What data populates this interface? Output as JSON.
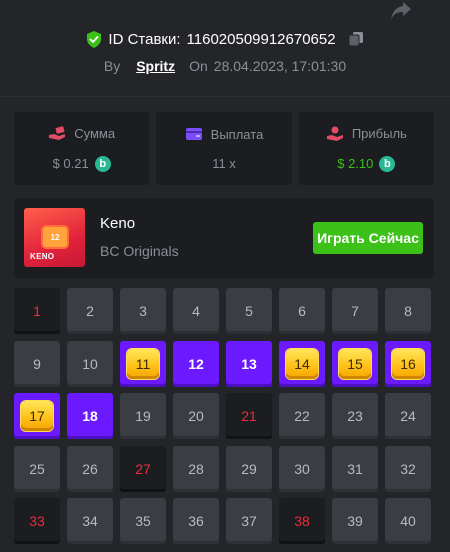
{
  "header": {
    "bet_id_label": "ID Ставки:",
    "bet_id_value": "116020509912670652",
    "by_label": "By",
    "user": "Spritz",
    "on_label": "On",
    "date": "28.04.2023, 17:01:30",
    "icons": {
      "share": "share-icon",
      "shield": "shield-check-icon",
      "copy": "copy-icon"
    },
    "colors": {
      "shield": "#3bc117"
    }
  },
  "stats": [
    {
      "label": "Сумма",
      "value": "$ 0.21",
      "icon": "money-hand-icon",
      "coin": true
    },
    {
      "label": "Выплата",
      "value": "11 x",
      "icon": "wallet-icon",
      "coin": false
    },
    {
      "label": "Прибыль",
      "value": "$ 2.10",
      "icon": "coins-hand-icon",
      "coin": true
    }
  ],
  "coin_symbol": "b",
  "game": {
    "name": "Keno",
    "provider": "BC Originals",
    "play_label": "Играть Сейчас",
    "thumb_logo": "KENO",
    "thumb_tile": "12"
  },
  "colors": {
    "accent_green": "#3bc117",
    "picked": "#6b19ff",
    "miss_text": "#ed2c3c",
    "gem": "#ffc21a"
  },
  "grid": {
    "numbers": [
      "1",
      "2",
      "3",
      "4",
      "5",
      "6",
      "7",
      "8",
      "9",
      "10",
      "11",
      "12",
      "13",
      "14",
      "15",
      "16",
      "17",
      "18",
      "19",
      "20",
      "21",
      "22",
      "23",
      "24",
      "25",
      "26",
      "27",
      "28",
      "29",
      "30",
      "31",
      "32",
      "33",
      "34",
      "35",
      "36",
      "37",
      "38",
      "39",
      "40"
    ],
    "states": [
      "miss",
      "normal",
      "normal",
      "normal",
      "normal",
      "normal",
      "normal",
      "normal",
      "normal",
      "normal",
      "hit",
      "picked",
      "picked",
      "hit",
      "hit",
      "hit",
      "hit",
      "picked",
      "normal",
      "normal",
      "miss",
      "normal",
      "normal",
      "normal",
      "normal",
      "normal",
      "miss",
      "normal",
      "normal",
      "normal",
      "normal",
      "normal",
      "miss",
      "normal",
      "normal",
      "normal",
      "normal",
      "miss",
      "normal",
      "normal"
    ]
  }
}
